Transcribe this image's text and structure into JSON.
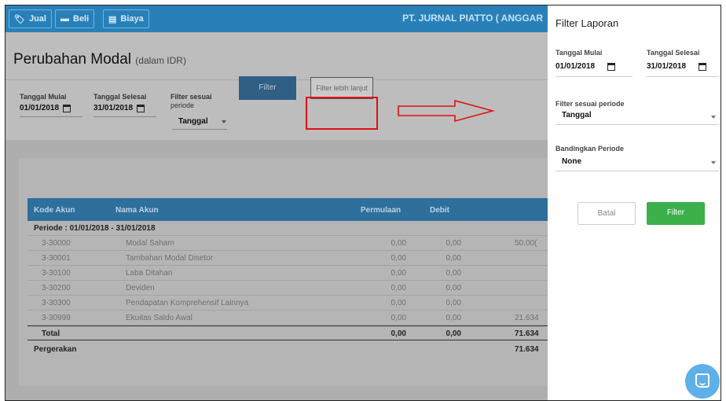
{
  "topbar": {
    "buttons": [
      {
        "icon": "tag-icon",
        "glyph": "🏷",
        "label": "Jual"
      },
      {
        "icon": "card-icon",
        "glyph": "▬",
        "label": "Beli"
      },
      {
        "icon": "receipt-icon",
        "glyph": "▤",
        "label": "Biaya"
      }
    ],
    "company": "PT. JURNAL PIATTO ( ANGGAR"
  },
  "page": {
    "title": "Perubahan Modal",
    "title_sub": "(dalam IDR)"
  },
  "filters": {
    "start_label": "Tanggal Mulai",
    "start_value": "01/01/2018",
    "end_label": "Tanggal Selesai",
    "end_value": "31/01/2018",
    "period_label_1": "Filter sesuai",
    "period_label_2": "periode",
    "period_value": "Tanggal",
    "filter_button": "Filter",
    "more_button": "Filter lebih lanjut"
  },
  "table": {
    "headers": [
      "Kode Akun",
      "Nama Akun",
      "Permulaan",
      "Debit"
    ],
    "period_row": "Periode : 01/01/2018 - 31/01/2018",
    "rows": [
      [
        "3-30000",
        "Modal Saham",
        "0,00",
        "0,00",
        "50.00("
      ],
      [
        "3-30001",
        "Tambahan Modal Disetor",
        "0,00",
        "0,00",
        ""
      ],
      [
        "3-30100",
        "Laba Ditahan",
        "0,00",
        "0,00",
        ""
      ],
      [
        "3-30200",
        "Deviden",
        "0,00",
        "0,00",
        ""
      ],
      [
        "3-30300",
        "Pendapatan Komprehensif Lainnya",
        "0,00",
        "0,00",
        ""
      ],
      [
        "3-30999",
        "Ekuitas Saldo Awal",
        "0,00",
        "0,00",
        "21.634"
      ]
    ],
    "total": [
      "Total",
      "0,00",
      "0,00",
      "71.634"
    ],
    "movement": [
      "Pergerakan",
      "71.634"
    ]
  },
  "side_panel": {
    "title": "Filter Laporan",
    "start_label": "Tanggal Mulai",
    "start_value": "01/01/2018",
    "end_label": "Tanggal Selesai",
    "end_value": "31/01/2018",
    "period_label": "Filter sesuai periode",
    "period_value": "Tanggal",
    "compare_label": "Bandingkan Periode",
    "compare_value": "None",
    "cancel_button": "Batal",
    "filter_button": "Filter"
  },
  "colors": {
    "topbar": "#2980b9",
    "table_header": "#2e6f9c",
    "filter_green": "#3cb04a",
    "annotation_red": "#e01010",
    "chat_bubble": "#5db0e8"
  }
}
